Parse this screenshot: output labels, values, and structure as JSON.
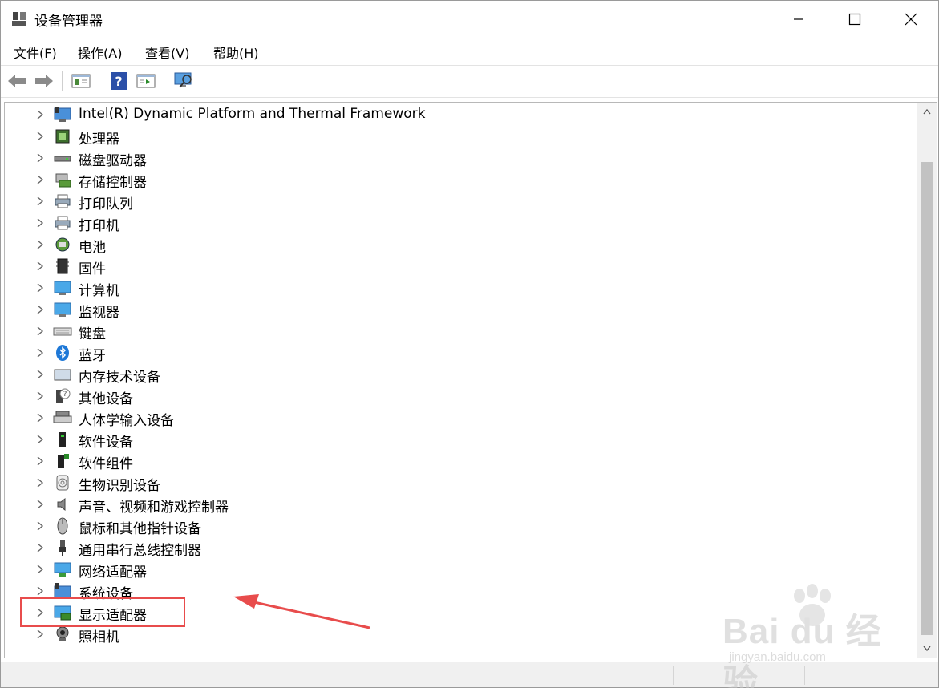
{
  "window": {
    "title": "设备管理器"
  },
  "menu": [
    {
      "label": "文件(F)"
    },
    {
      "label": "操作(A)"
    },
    {
      "label": "查看(V)"
    },
    {
      "label": "帮助(H)"
    }
  ],
  "tree": {
    "items": [
      {
        "label": "Intel(R) Dynamic Platform and Thermal Framework",
        "icon": "thermal-framework-icon"
      },
      {
        "label": "处理器",
        "icon": "processor-icon"
      },
      {
        "label": "磁盘驱动器",
        "icon": "disk-drive-icon"
      },
      {
        "label": "存储控制器",
        "icon": "storage-controller-icon"
      },
      {
        "label": "打印队列",
        "icon": "print-queue-icon"
      },
      {
        "label": "打印机",
        "icon": "printer-icon"
      },
      {
        "label": "电池",
        "icon": "battery-icon"
      },
      {
        "label": "固件",
        "icon": "firmware-icon"
      },
      {
        "label": "计算机",
        "icon": "computer-icon"
      },
      {
        "label": "监视器",
        "icon": "monitor-icon"
      },
      {
        "label": "键盘",
        "icon": "keyboard-icon"
      },
      {
        "label": "蓝牙",
        "icon": "bluetooth-icon"
      },
      {
        "label": "内存技术设备",
        "icon": "memory-device-icon"
      },
      {
        "label": "其他设备",
        "icon": "other-device-icon"
      },
      {
        "label": "人体学输入设备",
        "icon": "hid-icon"
      },
      {
        "label": "软件设备",
        "icon": "software-device-icon"
      },
      {
        "label": "软件组件",
        "icon": "software-component-icon"
      },
      {
        "label": "生物识别设备",
        "icon": "biometric-icon"
      },
      {
        "label": "声音、视频和游戏控制器",
        "icon": "audio-icon"
      },
      {
        "label": "鼠标和其他指针设备",
        "icon": "mouse-icon"
      },
      {
        "label": "通用串行总线控制器",
        "icon": "usb-icon"
      },
      {
        "label": "网络适配器",
        "icon": "network-adapter-icon"
      },
      {
        "label": "系统设备",
        "icon": "system-device-icon"
      },
      {
        "label": "显示适配器",
        "icon": "display-adapter-icon"
      },
      {
        "label": "照相机",
        "icon": "camera-icon"
      }
    ]
  },
  "watermark": {
    "brand": "Bai du 经验",
    "url": "jingyan.baidu.com"
  },
  "colors": {
    "highlight": "#e84c4c",
    "accent": "#1e78d7"
  }
}
